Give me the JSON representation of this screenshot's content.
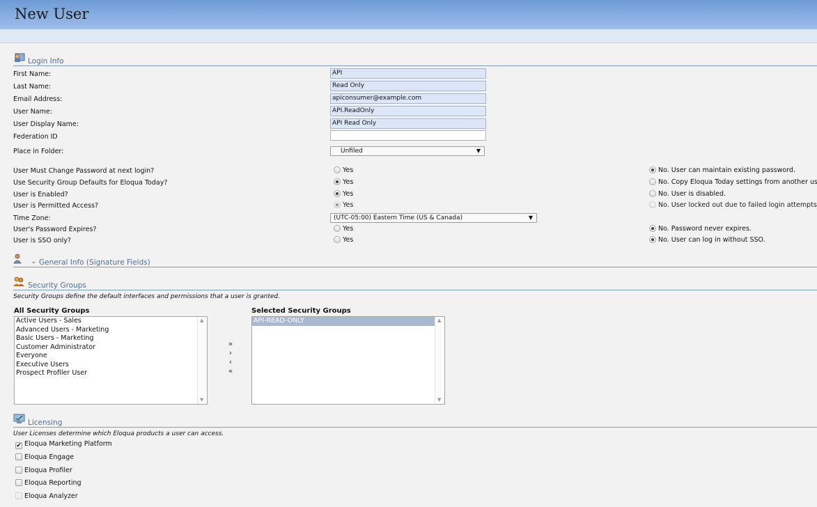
{
  "header": {
    "title": "New User"
  },
  "login_info": {
    "section_title": "Login Info",
    "fields": [
      {
        "label": "First Name:",
        "value": "API"
      },
      {
        "label": "Last Name:",
        "value": "Read Only"
      },
      {
        "label": "Email Address:",
        "value": "apiconsumer@example.com"
      },
      {
        "label": "User Name:",
        "value": "API.ReadOnly"
      },
      {
        "label": "User Display Name:",
        "value": "API Read Only"
      },
      {
        "label": "Federation ID",
        "value": ""
      }
    ],
    "folder": {
      "label": "Place in Folder:",
      "value": "Unfiled"
    },
    "options": [
      {
        "label": "User Must Change Password at next login?",
        "yes": "Yes",
        "no": "No. User can maintain existing password.",
        "selected": "no"
      },
      {
        "label": "Use Security Group Defaults for Eloqua Today?",
        "yes": "Yes",
        "no": "No. Copy Eloqua Today settings from another user.",
        "selected": "yes"
      },
      {
        "label": "User is Enabled?",
        "yes": "Yes",
        "no": "No. User is disabled.",
        "selected": "yes"
      },
      {
        "label": "User is Permitted Access?",
        "yes": "Yes",
        "no": "No. User locked out due to failed login attempts.",
        "selected": "yes",
        "disabled": true
      },
      {
        "label": "User's Password Expires?",
        "yes": "Yes",
        "no": "No. Password never expires.",
        "selected": "no"
      },
      {
        "label": "User is SSO only?",
        "yes": "Yes",
        "no": "No. User can log in without SSO.",
        "selected": "no"
      }
    ],
    "timezone": {
      "label": "Time Zone:",
      "value": "(UTC-05:00) Eastern Time (US & Canada)"
    }
  },
  "general_info": {
    "section_title": "General Info (Signature Fields)"
  },
  "security_groups": {
    "section_title": "Security Groups",
    "description": "Security Groups define the default interfaces and permissions that a user is granted.",
    "all_label": "All Security Groups",
    "selected_label": "Selected Security Groups",
    "all_groups": [
      "Active Users - Sales",
      "Advanced Users - Marketing",
      "Basic Users - Marketing",
      "Customer Administrator",
      "Everyone",
      "Executive Users",
      "Prospect Profiler User"
    ],
    "selected_groups": [
      "API-READ-ONLY"
    ],
    "buttons": {
      "add_all": "»",
      "add": "›",
      "remove": "‹",
      "remove_all": "«"
    }
  },
  "licensing": {
    "section_title": "Licensing",
    "description": "User Licenses determine which Eloqua products a user can access.",
    "licenses": [
      {
        "label": "Eloqua Marketing Platform",
        "checked": true
      },
      {
        "label": "Eloqua Engage",
        "checked": false
      },
      {
        "label": "Eloqua Profiler",
        "checked": false
      },
      {
        "label": "Eloqua Reporting",
        "checked": false
      },
      {
        "label": "Eloqua Analyzer",
        "checked": false,
        "disabled": true
      }
    ]
  }
}
